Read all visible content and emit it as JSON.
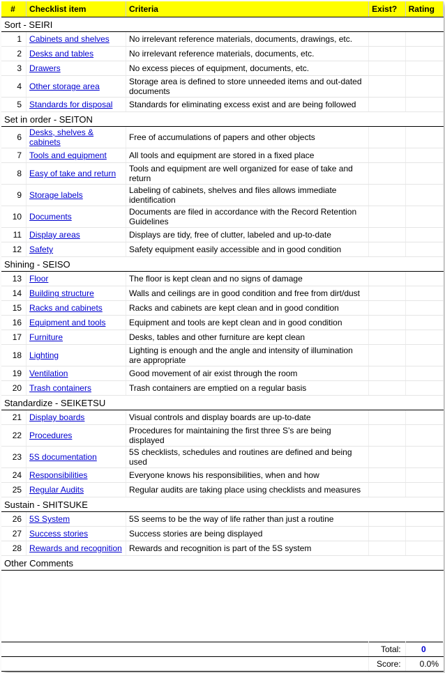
{
  "headers": {
    "num": "#",
    "item": "Checklist item",
    "criteria": "Criteria",
    "exist": "Exist?",
    "rating": "Rating"
  },
  "sections": [
    {
      "title": "Sort - SEIRI",
      "rows": [
        {
          "n": 1,
          "item": "Cabinets and shelves",
          "criteria": "No irrelevant reference materials, documents, drawings, etc."
        },
        {
          "n": 2,
          "item": "Desks and tables",
          "criteria": "No irrelevant reference materials, documents, etc."
        },
        {
          "n": 3,
          "item": "Drawers",
          "criteria": "No excess pieces of equipment, documents, etc."
        },
        {
          "n": 4,
          "item": "Other storage area",
          "criteria": "Storage area is defined to store unneeded items and out-dated documents"
        },
        {
          "n": 5,
          "item": "Standards for disposal",
          "criteria": "Standards for eliminating excess exist and are being followed"
        }
      ]
    },
    {
      "title": "Set in order - SEITON",
      "rows": [
        {
          "n": 6,
          "item": "Desks, shelves & cabinets",
          "criteria": "Free of accumulations of papers and other objects"
        },
        {
          "n": 7,
          "item": "Tools and equipment",
          "criteria": "All tools and equipment are stored in a fixed place"
        },
        {
          "n": 8,
          "item": "Easy of take and return",
          "criteria": "Tools and equipment are well organized for ease of take and return"
        },
        {
          "n": 9,
          "item": "Storage labels",
          "criteria": "Labeling of cabinets, shelves and files allows immediate identification"
        },
        {
          "n": 10,
          "item": "Documents",
          "criteria": "Documents are filed in accordance with the Record Retention Guidelines"
        },
        {
          "n": 11,
          "item": "Display areas",
          "criteria": "Displays are tidy, free of clutter, labeled and up-to-date"
        },
        {
          "n": 12,
          "item": "Safety",
          "criteria": "Safety equipment easily accessible and in good condition"
        }
      ]
    },
    {
      "title": "Shining - SEISO",
      "rows": [
        {
          "n": 13,
          "item": "Floor",
          "criteria": "The floor is kept clean and no signs of damage"
        },
        {
          "n": 14,
          "item": "Building structure",
          "criteria": "Walls and ceilings are in good condition and free from dirt/dust"
        },
        {
          "n": 15,
          "item": "Racks and cabinets",
          "criteria": "Racks and cabinets are kept clean and in good condition"
        },
        {
          "n": 16,
          "item": "Equipment and tools",
          "criteria": "Equipment and tools are kept clean and in good condition"
        },
        {
          "n": 17,
          "item": "Furniture",
          "criteria": "Desks, tables and other furniture are kept clean"
        },
        {
          "n": 18,
          "item": "Lighting",
          "criteria": "Lighting is enough and the angle and intensity of illumination are appropriate"
        },
        {
          "n": 19,
          "item": "Ventilation",
          "criteria": "Good movement of air exist through the room"
        },
        {
          "n": 20,
          "item": "Trash containers",
          "criteria": "Trash containers are emptied on a regular basis"
        }
      ]
    },
    {
      "title": "Standardize - SEIKETSU",
      "rows": [
        {
          "n": 21,
          "item": "Display boards",
          "criteria": "Visual controls and display boards are up-to-date"
        },
        {
          "n": 22,
          "item": "Procedures",
          "criteria": "Procedures for maintaining the first three S's are being displayed"
        },
        {
          "n": 23,
          "item": "5S documentation",
          "criteria": "5S checklists, schedules and routines are defined and being used"
        },
        {
          "n": 24,
          "item": "Responsibilities",
          "criteria": "Everyone knows his responsibilities, when and how"
        },
        {
          "n": 25,
          "item": "Regular Audits",
          "criteria": "Regular audits are taking place using checklists and measures"
        }
      ]
    },
    {
      "title": "Sustain - SHITSUKE",
      "rows": [
        {
          "n": 26,
          "item": "5S System",
          "criteria": "5S seems to be the way of life rather than just a routine"
        },
        {
          "n": 27,
          "item": "Success stories",
          "criteria": "Success stories are being displayed"
        },
        {
          "n": 28,
          "item": "Rewards and recognition",
          "criteria": "Rewards and recognition is part of the 5S system"
        }
      ]
    },
    {
      "title": "Other Comments",
      "rows": []
    }
  ],
  "footer": {
    "total_label": "Total:",
    "total_value": "0",
    "score_label": "Score:",
    "score_value": "0.0%"
  }
}
